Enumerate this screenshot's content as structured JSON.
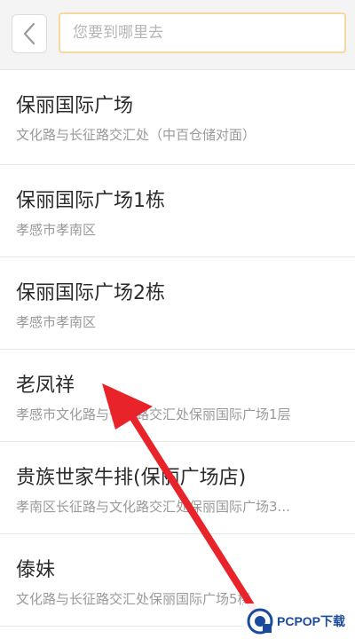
{
  "search": {
    "placeholder": "您要到哪里去",
    "value": ""
  },
  "results": [
    {
      "name": "保丽国际广场",
      "address": "文化路与长征路交汇处（中百仓储对面）"
    },
    {
      "name": "保丽国际广场1栋",
      "address": "孝感市孝南区"
    },
    {
      "name": "保丽国际广场2栋",
      "address": "孝感市孝南区"
    },
    {
      "name": "老凤祥",
      "address": "孝感市文化路与长征路交汇处保丽国际广场1层"
    },
    {
      "name": "贵族世家牛排(保丽广场店)",
      "address": "孝南区长征路与文化路交汇处保丽国际广场3..."
    },
    {
      "name": "傣妹",
      "address": "文化路与长征路交汇处保丽国际广场5楼"
    }
  ],
  "watermark": {
    "text": "PCPOP下载"
  },
  "icons": {
    "back": "chevron-left-icon",
    "annotation": "red-arrow-icon",
    "watermark_logo": "pcpop-logo-icon"
  },
  "colors": {
    "arrow": "#e8232a",
    "search_border": "#f5d9a3",
    "watermark_text": "#1a4a9c"
  }
}
